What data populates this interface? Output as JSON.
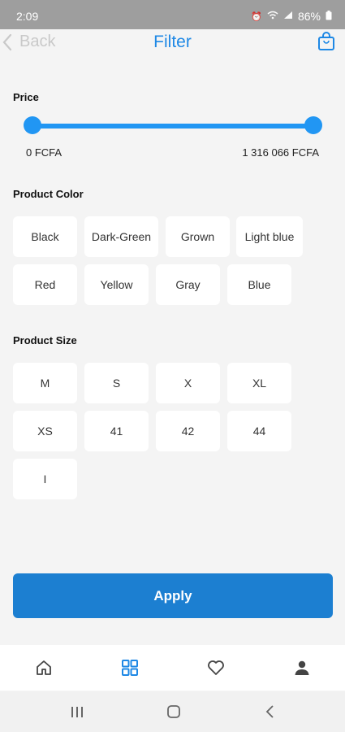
{
  "status": {
    "time": "2:09",
    "battery": "86%"
  },
  "appbar": {
    "back_label": "Back",
    "title": "Filter"
  },
  "price": {
    "title": "Price",
    "min_label": "0 FCFA",
    "max_label": "1 316 066 FCFA",
    "range": [
      0,
      1
    ]
  },
  "colors": {
    "title": "Product Color",
    "items": [
      "Black",
      "Dark-Green",
      "Grown",
      "Light blue",
      "Red",
      "Yellow",
      "Gray",
      "Blue"
    ]
  },
  "sizes": {
    "title": "Product Size",
    "items": [
      "M",
      "S",
      "X",
      "XL",
      "XS",
      "41",
      "42",
      "44",
      "I"
    ]
  },
  "apply_label": "Apply",
  "bottom_nav": [
    "home-icon",
    "grid-icon",
    "heart-icon",
    "person-icon"
  ],
  "accent": "#1e88e5"
}
